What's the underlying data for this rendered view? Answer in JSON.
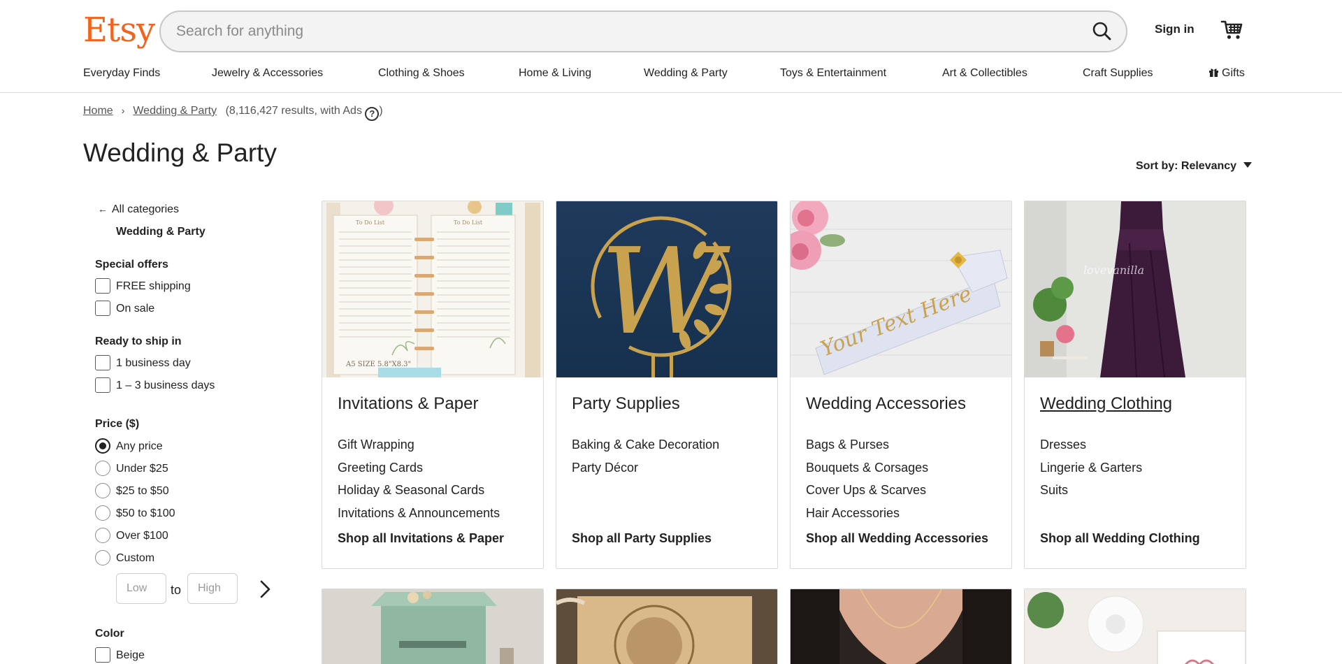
{
  "header": {
    "logo": "Etsy",
    "search_placeholder": "Search for anything",
    "sign_in": "Sign in",
    "brand_color": "#f1641e"
  },
  "nav": {
    "items": [
      "Everyday Finds",
      "Jewelry & Accessories",
      "Clothing & Shoes",
      "Home & Living",
      "Wedding & Party",
      "Toys & Entertainment",
      "Art & Collectibles",
      "Craft Supplies",
      "Gifts"
    ]
  },
  "breadcrumb": {
    "home": "Home",
    "current": "Wedding & Party",
    "results": "(8,116,427 results, with Ads",
    "help": "?",
    "close_paren": ")"
  },
  "page": {
    "title": "Wedding & Party",
    "sort": "Sort by: Relevancy"
  },
  "sidebar": {
    "all_categories": "All categories",
    "current_category": "Wedding & Party",
    "special_offers": {
      "heading": "Special offers",
      "options": [
        "FREE shipping",
        "On sale"
      ]
    },
    "ready_to_ship": {
      "heading": "Ready to ship in",
      "options": [
        "1 business day",
        "1 – 3 business days"
      ]
    },
    "price": {
      "heading": "Price ($)",
      "options": [
        "Any price",
        "Under $25",
        "$25 to $50",
        "$50 to $100",
        "Over $100",
        "Custom"
      ],
      "selected": "Any price",
      "low_placeholder": "Low",
      "to": "to",
      "high_placeholder": "High"
    },
    "color": {
      "heading": "Color",
      "options": [
        "Beige"
      ]
    }
  },
  "categories": [
    {
      "title": "Invitations & Paper",
      "links": [
        "Gift Wrapping",
        "Greeting Cards",
        "Holiday & Seasonal Cards",
        "Invitations & Announcements"
      ],
      "shop_all": "Shop all Invitations & Paper",
      "image_text": {
        "left": "To Do List",
        "right": "To Do List",
        "size": "A5 SIZE 5.8\"X8.3\""
      }
    },
    {
      "title": "Party Supplies",
      "links": [
        "Baking & Cake Decoration",
        "Party Décor"
      ],
      "shop_all": "Shop all Party Supplies",
      "image_text": {
        "letter": "W"
      }
    },
    {
      "title": "Wedding Accessories",
      "links": [
        "Bags & Purses",
        "Bouquets & Corsages",
        "Cover Ups & Scarves",
        "Hair Accessories"
      ],
      "shop_all": "Shop all Wedding Accessories",
      "image_text": {
        "sash": "Your Text Here"
      }
    },
    {
      "title": "Wedding Clothing",
      "links": [
        "Dresses",
        "Lingerie & Garters",
        "Suits"
      ],
      "shop_all": "Shop all Wedding Clothing",
      "image_text": {
        "watermark": "lovevanilla"
      }
    }
  ]
}
